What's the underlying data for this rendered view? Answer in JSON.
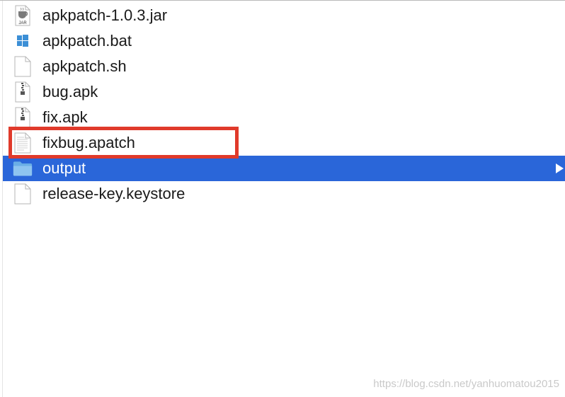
{
  "files": [
    {
      "name": "apkpatch-1.0.3.jar",
      "icon": "jar-file-icon",
      "selected": false
    },
    {
      "name": "apkpatch.bat",
      "icon": "windows-bat-file-icon",
      "selected": false
    },
    {
      "name": "apkpatch.sh",
      "icon": "blank-document-icon",
      "selected": false
    },
    {
      "name": "bug.apk",
      "icon": "zip-archive-icon",
      "selected": false
    },
    {
      "name": "fix.apk",
      "icon": "zip-archive-icon",
      "selected": false
    },
    {
      "name": "fixbug.apatch",
      "icon": "text-document-icon",
      "selected": false
    },
    {
      "name": "output",
      "icon": "folder-icon",
      "selected": true
    },
    {
      "name": "release-key.keystore",
      "icon": "blank-document-icon",
      "selected": false
    }
  ],
  "jar_badge": "JAR",
  "watermark": "https://blog.csdn.net/yanhuomatou2015",
  "colors": {
    "selection": "#2a66d9",
    "highlight_box": "#e03a2b",
    "folder": "#7fb8ea"
  }
}
